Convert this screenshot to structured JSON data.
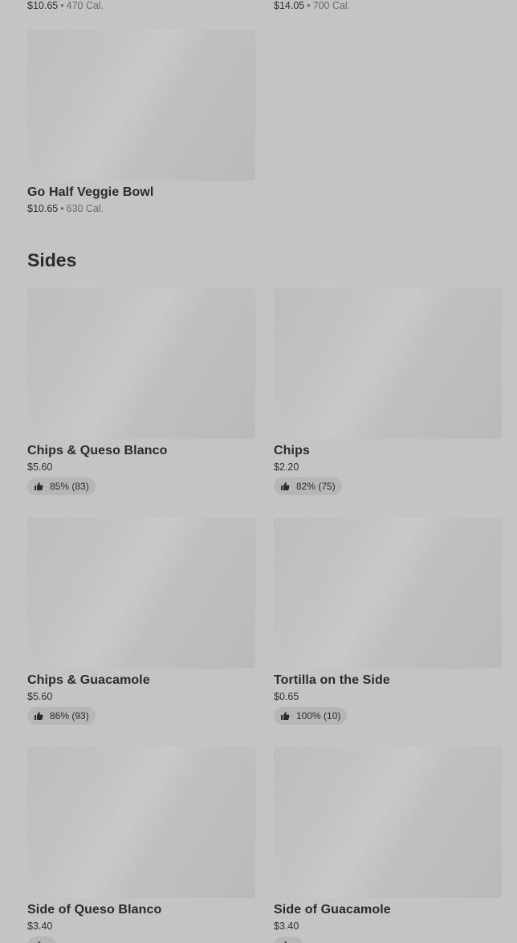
{
  "top_items": [
    {
      "price": "$10.65",
      "calories": "470 Cal."
    },
    {
      "price": "$14.05",
      "calories": "700 Cal."
    }
  ],
  "veggie_bowl": {
    "name": "Go Half Veggie Bowl",
    "price": "$10.65",
    "calories": "630 Cal."
  },
  "sides": {
    "title": "Sides",
    "items": [
      {
        "name": "Chips & Queso Blanco",
        "price": "$5.60",
        "rating": "85% (83)"
      },
      {
        "name": "Chips",
        "price": "$2.20",
        "rating": "82% (75)"
      },
      {
        "name": "Chips & Guacamole",
        "price": "$5.60",
        "rating": "86% (93)"
      },
      {
        "name": "Tortilla on the Side",
        "price": "$0.65",
        "rating": "100% (10)"
      },
      {
        "name": "Side of Queso Blanco",
        "price": "$3.40",
        "rating": ""
      },
      {
        "name": "Side of Guacamole",
        "price": "$3.40",
        "rating": ""
      }
    ]
  },
  "separator": "•",
  "icons": {
    "rating": "thumbs-up-icon"
  },
  "colors": {
    "background": "#c4c4c4",
    "pill": "#b6b6b6",
    "text": "#2a2a2a"
  }
}
